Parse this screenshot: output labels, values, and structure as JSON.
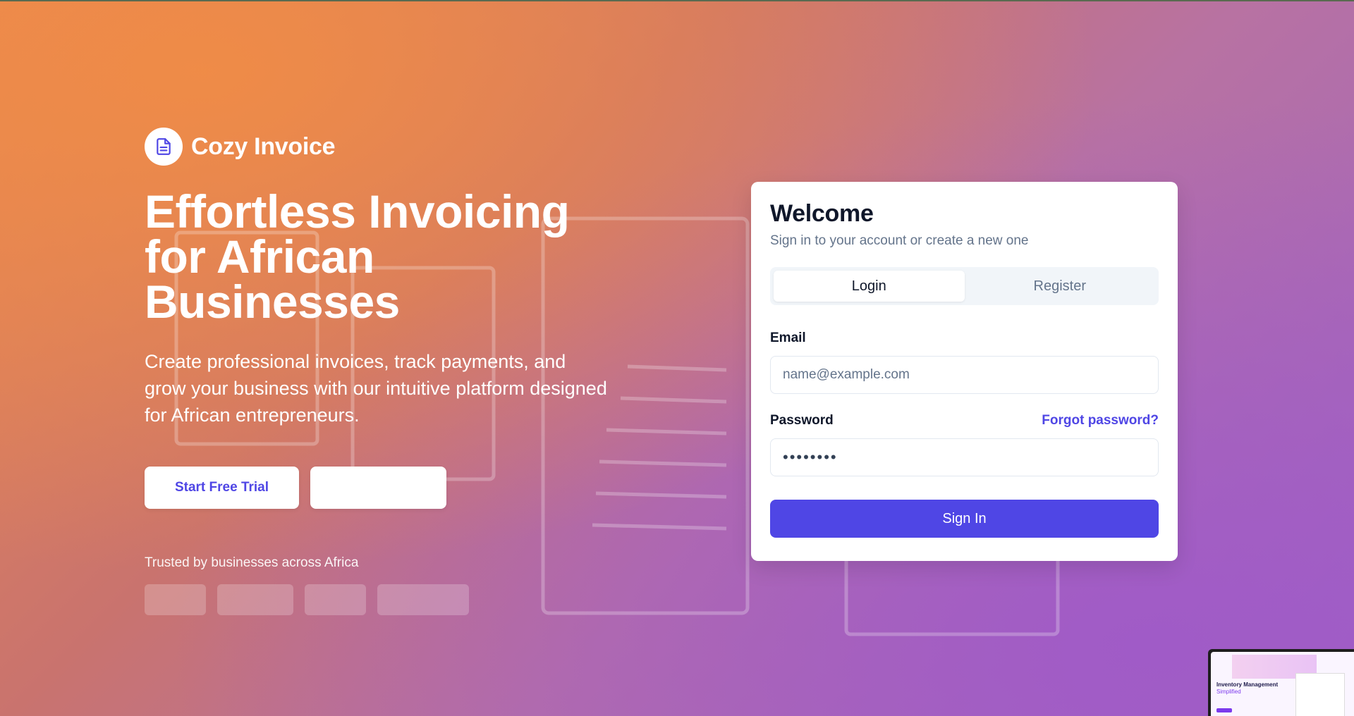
{
  "brand": {
    "name": "Cozy Invoice",
    "icon": "document-icon"
  },
  "hero": {
    "title": "Effortless Invoicing for African Businesses",
    "subtitle": "Create professional invoices, track payments, and grow your business with our intuitive platform designed for African entrepreneurs.",
    "primary_cta": "Start Free Trial",
    "secondary_cta": "",
    "trusted_text": "Trusted by businesses across Africa"
  },
  "auth_card": {
    "title": "Welcome",
    "subtitle": "Sign in to your account or create a new one",
    "tabs": [
      {
        "label": "Login",
        "active": true
      },
      {
        "label": "Register",
        "active": false
      }
    ],
    "email_label": "Email",
    "email_placeholder": "name@example.com",
    "password_label": "Password",
    "forgot_label": "Forgot password?",
    "password_value": "••••••••",
    "submit_label": "Sign In"
  },
  "thumbnail": {
    "title": "Inventory Management",
    "subtitle": "Simplified"
  },
  "colors": {
    "accent": "#4f46e5",
    "gradient_start": "#e88852",
    "gradient_end": "#9d63c4"
  }
}
